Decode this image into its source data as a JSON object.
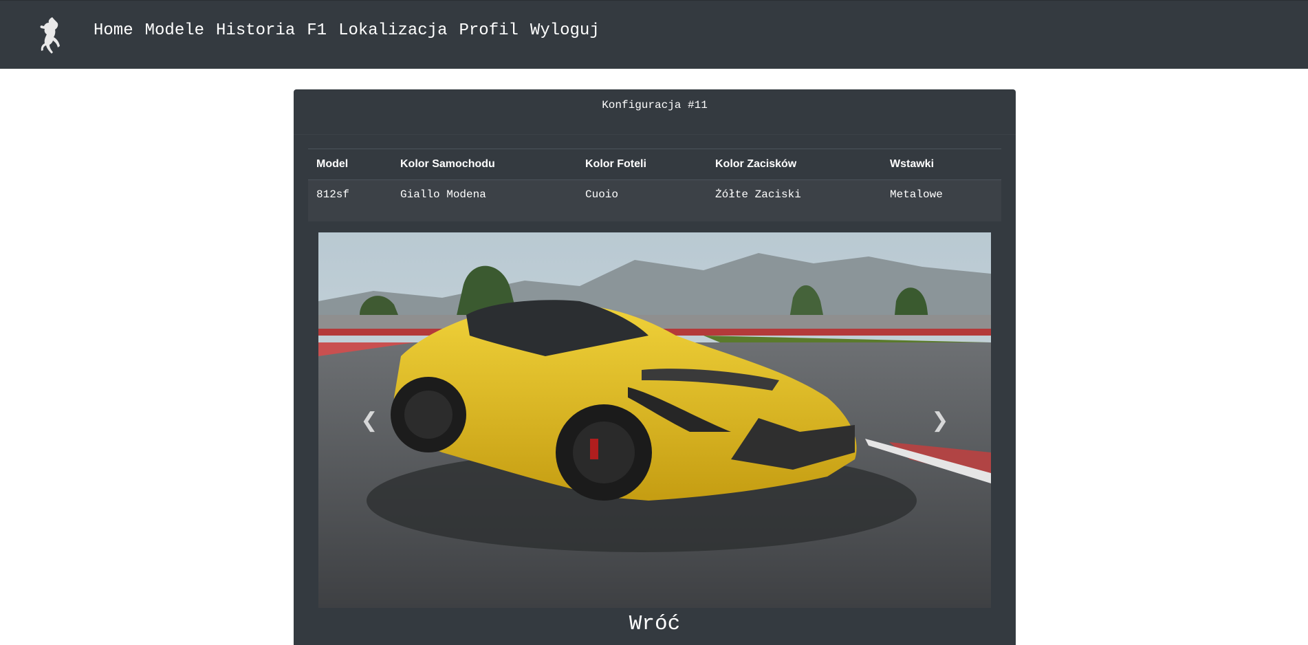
{
  "nav": {
    "logo_icon": "prancing-horse-icon",
    "links": [
      "Home",
      "Modele",
      "Historia",
      "F1",
      "Lokalizacja",
      "Profil",
      "Wyloguj"
    ]
  },
  "card": {
    "title": "Konfiguracja #11",
    "table": {
      "headers": [
        "Model",
        "Kolor Samochodu",
        "Kolor Foteli",
        "Kolor Zacisków",
        "Wstawki"
      ],
      "row": [
        "812sf",
        "Giallo Modena",
        "Cuoio",
        "Żółte Zaciski",
        "Metalowe"
      ]
    },
    "carousel": {
      "prev_icon": "chevron-left-icon",
      "next_icon": "chevron-right-icon",
      "prev_glyph": "❮",
      "next_glyph": "❯"
    },
    "back_label": "Wróć"
  },
  "colors": {
    "navbar": "#343a40",
    "card": "#343a40",
    "car_yellow": "#e3c21f"
  }
}
